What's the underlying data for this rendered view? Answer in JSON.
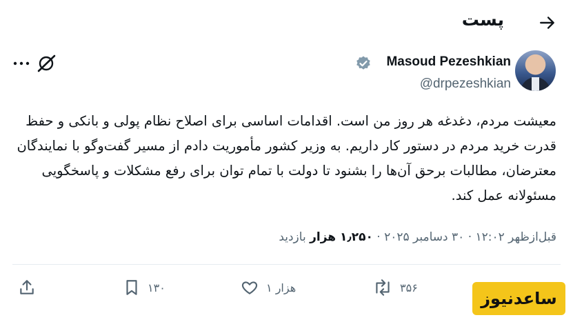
{
  "header": {
    "title": "پست",
    "back_icon": "arrow-right-icon"
  },
  "author": {
    "display_name": "Masoud Pezeshkian",
    "handle": "@drpezeshkian",
    "verified_color": "#829aab"
  },
  "tweet": {
    "text": "معیشت مردم، دغدغه هر روز من است. اقدامات اساسی برای اصلاح نظام پولی و بانکی و حفظ قدرت خرید مردم در دستور کار داریم. به وزیر کشور مأموریت دادم از مسیر گفت‌وگو با نمایندگان معترضان، مطالبات برحق آن‌ها را بشنود تا دولت با تمام توان برای رفع مشکلات و پاسخگویی مسئولانه عمل کند.",
    "time": "قبل‌ازظهر ۱۲:۰۲",
    "date": "۳۰ دسامبر ۲۰۲۵",
    "views_count": "۱٫۲۵۰ هزار",
    "views_label": "بازدید"
  },
  "actions": {
    "bookmarks": "۱۳۰",
    "likes": "۱ هزار",
    "reposts": "۳۵۶"
  },
  "watermark": {
    "text": "ساعدنیوز",
    "color": "#f4c51a"
  }
}
